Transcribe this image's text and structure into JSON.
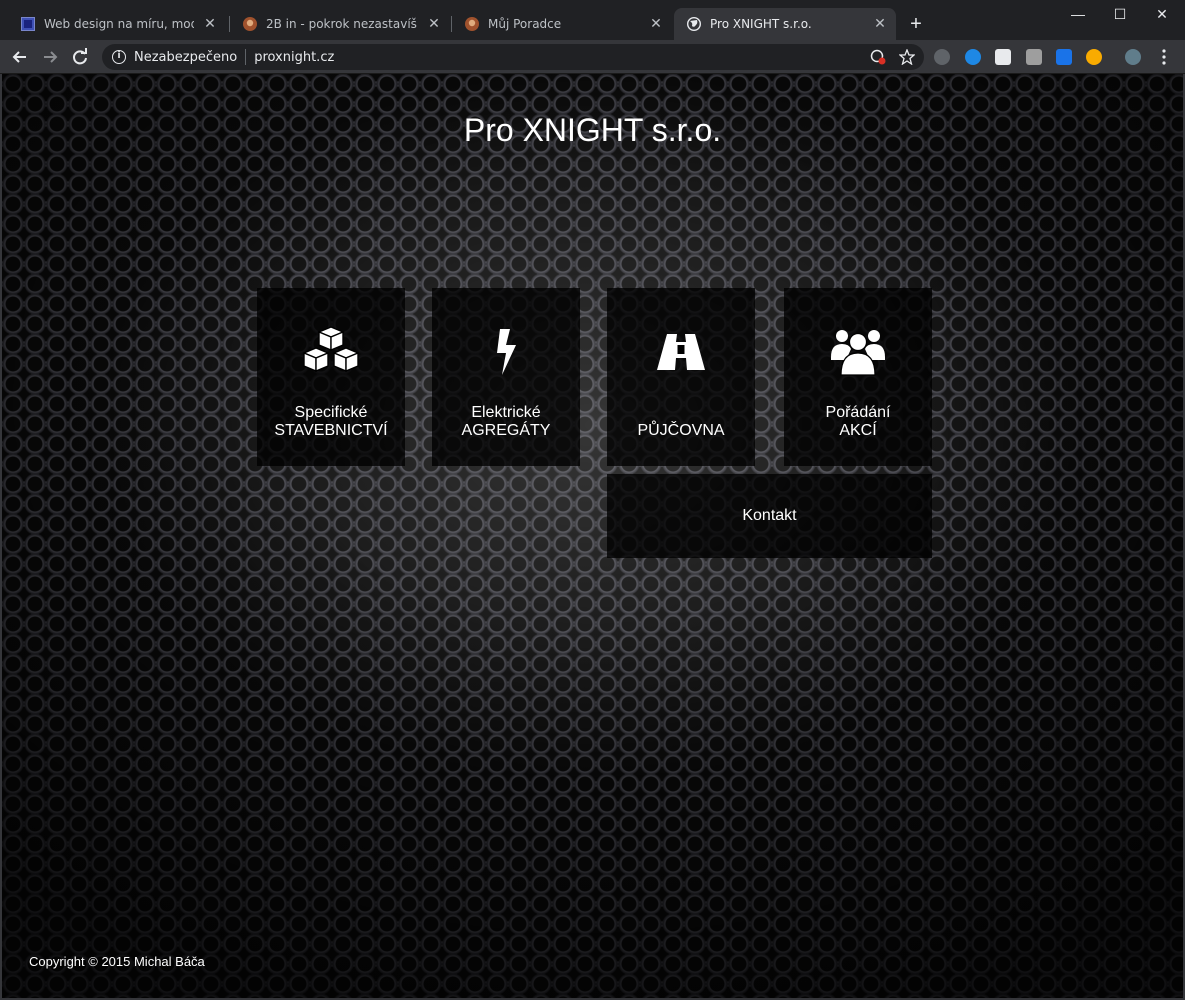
{
  "browser": {
    "tabs": [
      {
        "title": "Web design na míru, moderní, re",
        "active": false,
        "favicon": "square-logo-icon"
      },
      {
        "title": "2B in - pokrok nezastavíš",
        "active": false,
        "favicon": "avatar-icon"
      },
      {
        "title": "Můj Poradce",
        "active": false,
        "favicon": "avatar-icon"
      },
      {
        "title": "Pro XNIGHT s.r.o.",
        "active": true,
        "favicon": "globe-icon"
      }
    ],
    "close_glyph": "✕",
    "new_tab_glyph": "+",
    "window_controls": {
      "minimize": "—",
      "maximize": "☐",
      "close": "✕"
    },
    "omnibox": {
      "security_label": "Nezabezpečeno",
      "url": "proxnight.cz"
    },
    "colors": {
      "frame": "#202124",
      "toolbar": "#35363a",
      "text": "#e8eaed"
    }
  },
  "page": {
    "title": "Pro XNIGHT s.r.o.",
    "tiles": [
      {
        "line1": "Specifické",
        "line2": "STAVEBNICTVÍ",
        "icon": "cubes-icon"
      },
      {
        "line1": "Elektrické",
        "line2": "AGREGÁTY",
        "icon": "lightning-bolt-icon"
      },
      {
        "line1": "PŮJČOVNA",
        "line2": "",
        "icon": "road-icon"
      },
      {
        "line1": "Pořádání",
        "line2": "AKCÍ",
        "icon": "users-group-icon"
      }
    ],
    "contact": "Kontakt",
    "copyright": "Copyright © 2015 Michal Báča"
  }
}
